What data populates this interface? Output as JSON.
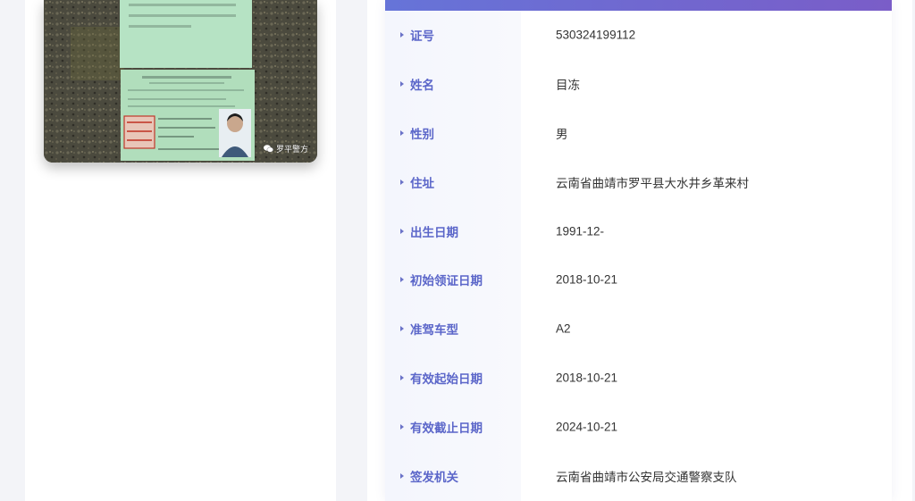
{
  "photo": {
    "watermark": "罗平警方"
  },
  "details": [
    {
      "label": "证号",
      "value": "530324199112"
    },
    {
      "label": "姓名",
      "value": "目冻"
    },
    {
      "label": "性别",
      "value": "男"
    },
    {
      "label": "住址",
      "value": "云南省曲靖市罗平县大水井乡革来村"
    },
    {
      "label": "出生日期",
      "value": "1991-12-"
    },
    {
      "label": "初始领证日期",
      "value": "2018-10-21"
    },
    {
      "label": "准驾车型",
      "value": "A2"
    },
    {
      "label": "有效起始日期",
      "value": "2018-10-21"
    },
    {
      "label": "有效截止日期",
      "value": "2024-10-21"
    },
    {
      "label": "签发机关",
      "value": "云南省曲靖市公安局交通警察支队"
    }
  ],
  "colors": {
    "accent": "#5b66c9",
    "header_gradient_start": "#6674d8",
    "header_gradient_end": "#7a5dc8"
  }
}
